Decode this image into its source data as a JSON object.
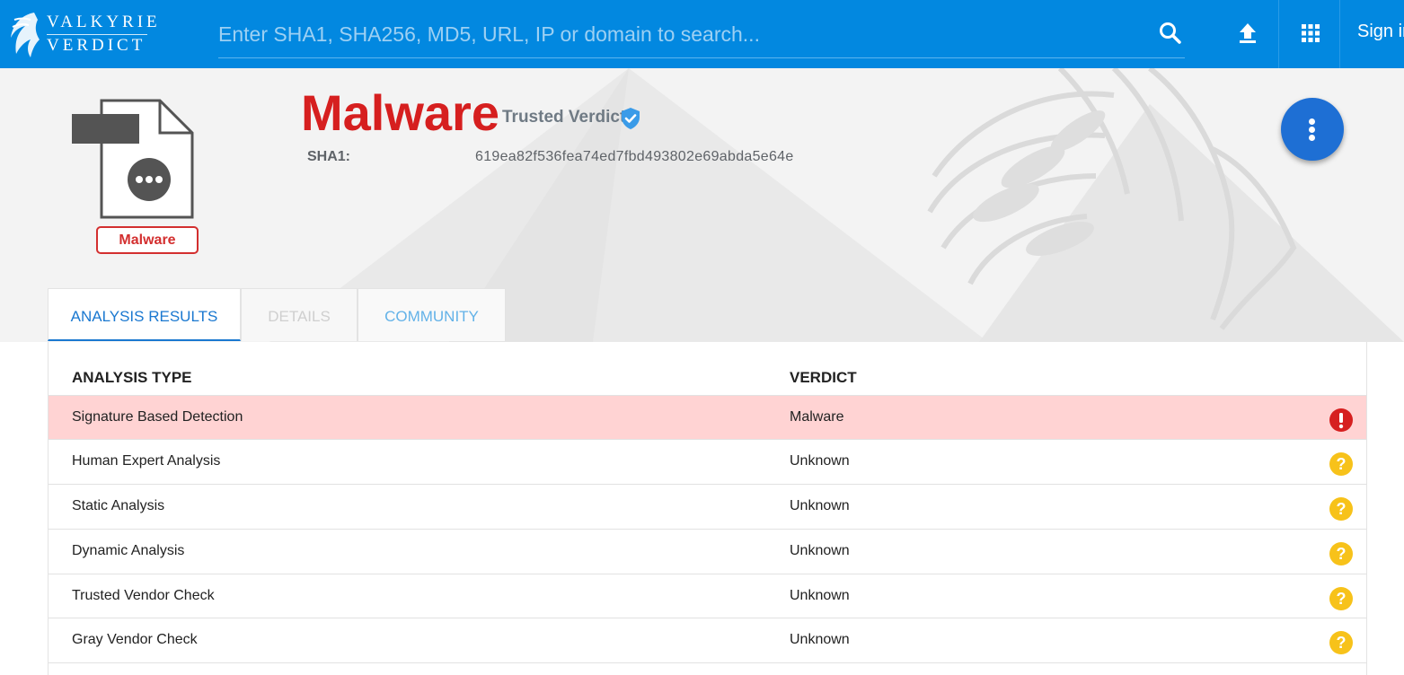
{
  "brand": {
    "line1": "VALKYRIE",
    "line2": "VERDICT"
  },
  "search": {
    "placeholder": "Enter SHA1, SHA256, MD5, URL, IP or domain to search...",
    "value": ""
  },
  "nav": {
    "sign_in": "Sign in"
  },
  "file": {
    "badge": "Malware"
  },
  "verdict": {
    "title": "Malware",
    "trusted_label": "Trusted Verdict",
    "sha1_label": "SHA1:",
    "sha1_value": "619ea82f536fea74ed7fbd493802e69abda5e64e"
  },
  "tabs": [
    {
      "label": "ANALYSIS RESULTS",
      "active": true
    },
    {
      "label": "DETAILS",
      "active": false
    },
    {
      "label": "COMMUNITY",
      "active": false
    }
  ],
  "table": {
    "headers": {
      "type": "ANALYSIS TYPE",
      "verdict": "VERDICT"
    },
    "rows": [
      {
        "type": "Signature Based Detection",
        "verdict": "Malware",
        "icon": "error-icon"
      },
      {
        "type": "Human Expert Analysis",
        "verdict": "Unknown",
        "icon": "question-icon"
      },
      {
        "type": "Static Analysis",
        "verdict": "Unknown",
        "icon": "question-icon"
      },
      {
        "type": "Dynamic Analysis",
        "verdict": "Unknown",
        "icon": "question-icon"
      },
      {
        "type": "Trusted Vendor Check",
        "verdict": "Unknown",
        "icon": "question-icon"
      },
      {
        "type": "Gray Vendor Check",
        "verdict": "Unknown",
        "icon": "question-icon"
      }
    ]
  },
  "colors": {
    "topbar": "#0288e0",
    "malware_red": "#d61f1f",
    "alert_row": "#ffd3d3",
    "unknown_yellow": "#f7c21a",
    "accent_blue": "#1a78d0",
    "fab_blue": "#1e6fd4"
  }
}
